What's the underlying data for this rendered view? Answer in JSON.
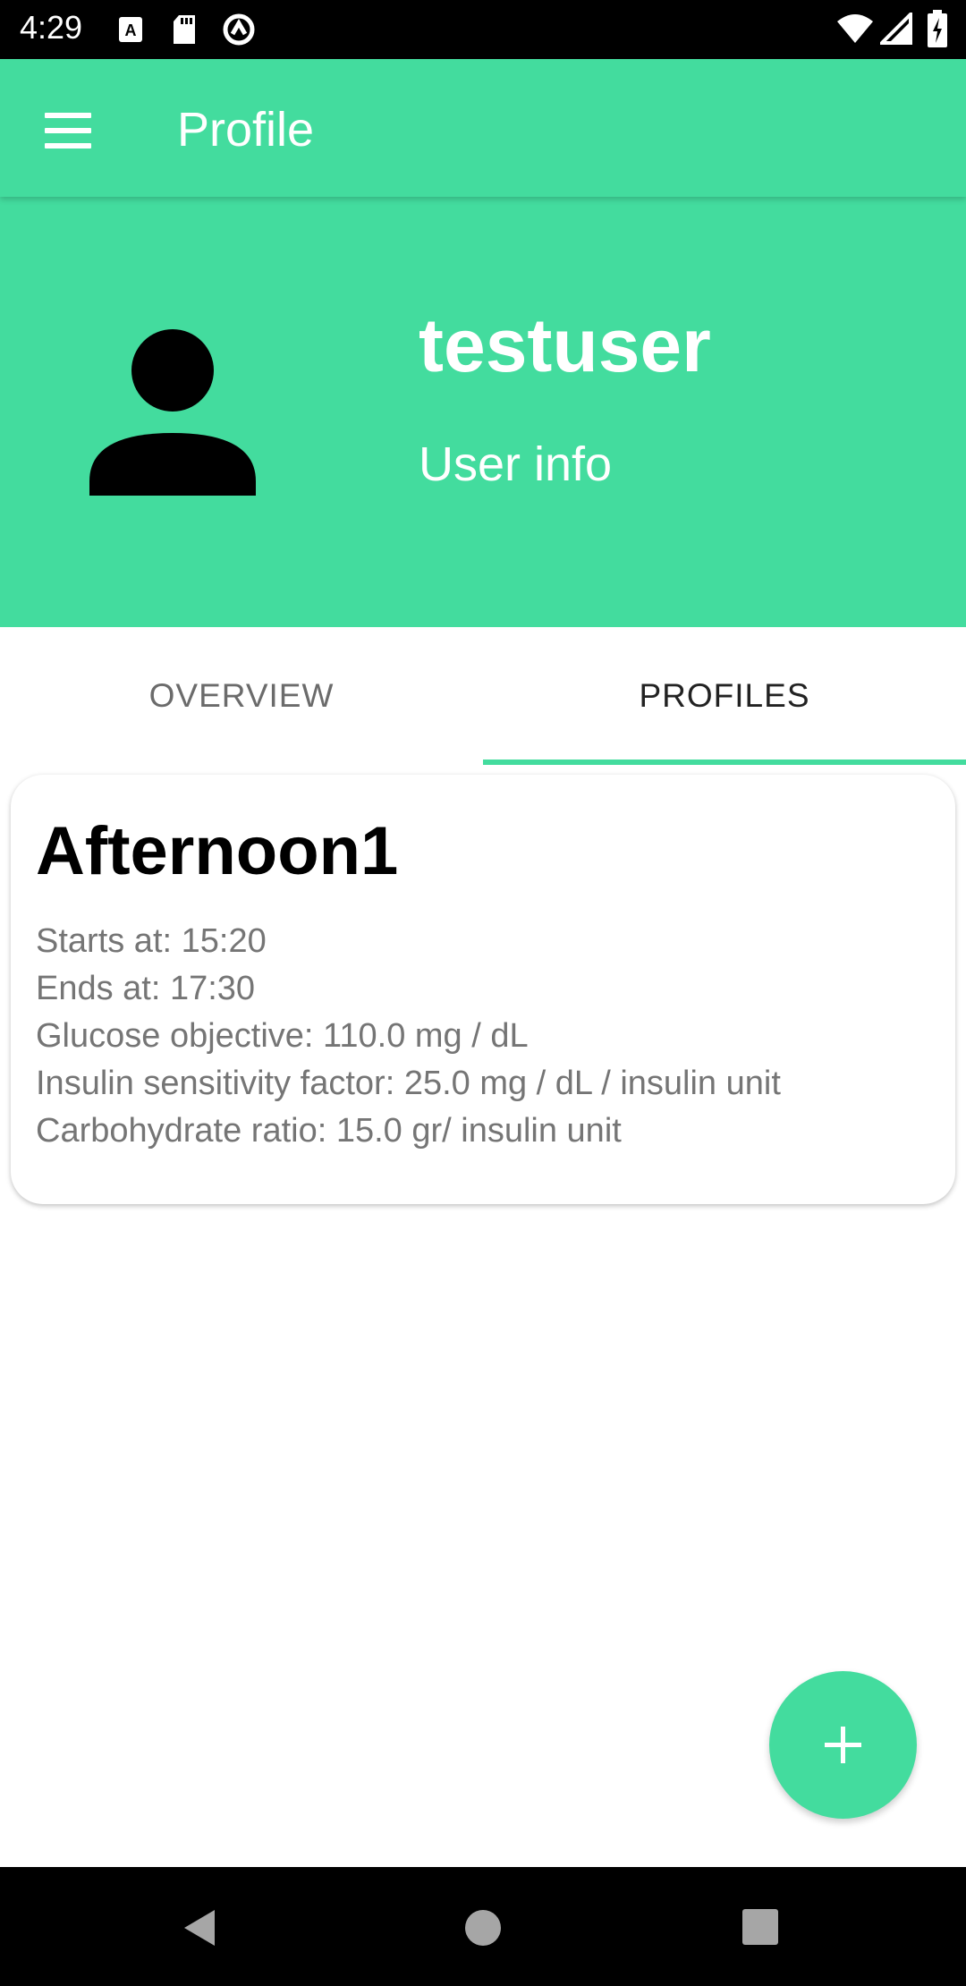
{
  "status_bar": {
    "time": "4:29",
    "left_icons": [
      "a-notification-icon",
      "sd-card-icon",
      "sync-icon"
    ],
    "right_icons": [
      "wifi-icon",
      "signal-icon",
      "battery-icon"
    ]
  },
  "app_bar": {
    "title": "Profile",
    "menu_icon": "menu-icon"
  },
  "header": {
    "username": "testuser",
    "subtitle": "User info",
    "avatar_icon": "person-icon"
  },
  "tabs": [
    {
      "label": "OVERVIEW",
      "selected": false
    },
    {
      "label": "PROFILES",
      "selected": true
    }
  ],
  "profile_card": {
    "name": "Afternoon1",
    "starts": "Starts at: 15:20",
    "ends": "Ends at: 17:30",
    "glucose": "Glucose objective: 110.0 mg / dL",
    "isf": "Insulin sensitivity factor: 25.0 mg / dL / insulin unit",
    "carb_ratio": "Carbohydrate ratio: 15.0 gr/ insulin unit"
  },
  "fab": {
    "icon": "add-icon"
  },
  "nav_bar": {
    "icons": [
      "back-icon",
      "home-icon",
      "recents-icon"
    ]
  },
  "colors": {
    "accent": "#43dc9e",
    "text_secondary": "#757575"
  }
}
